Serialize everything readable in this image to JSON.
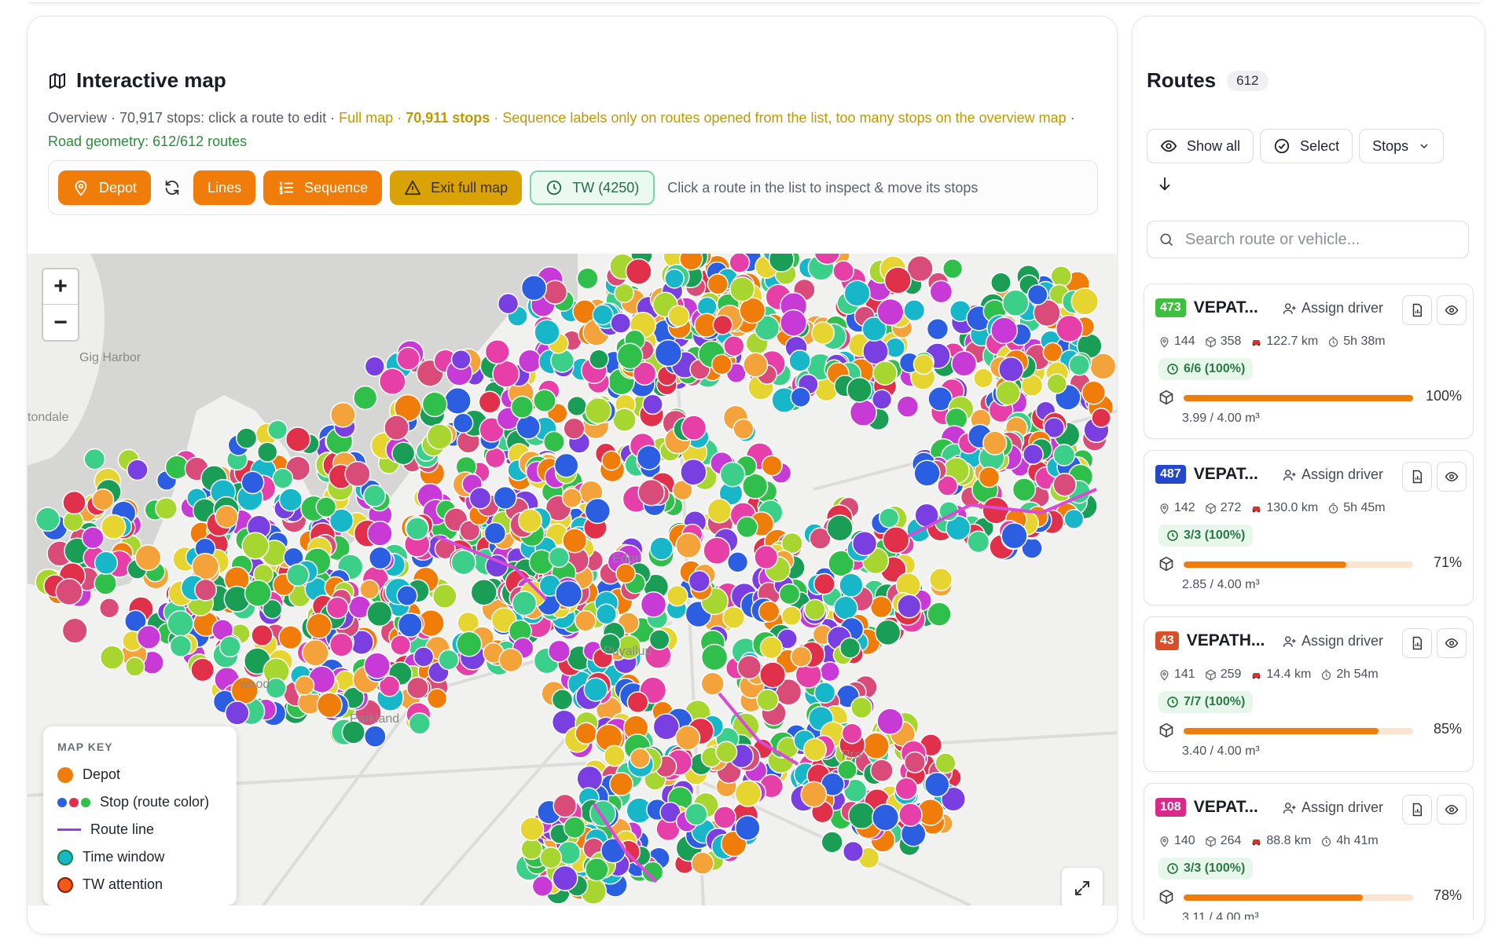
{
  "map": {
    "title": "Interactive map",
    "overview": {
      "part1": "Overview · 70,917 stops: click a route to edit · ",
      "part2": "Full map · ",
      "part3": "70,911 stops",
      "part4": " · Sequence labels only on routes opened from the list, too many stops on the overview map",
      "part5": " · Road geometry: 612/612 routes"
    },
    "toolbar": {
      "depot": "Depot",
      "lines": "Lines",
      "sequence": "Sequence",
      "exit_full_map": "Exit full map",
      "tw": "TW (4250)",
      "hint": "Click a route in the list to inspect & move its stops"
    },
    "places": [
      "Gig Harbor",
      "tondale",
      "Edge",
      "Puyallup",
      "wood",
      "Parkland",
      "Pra"
    ],
    "zoom_in": "+",
    "zoom_out": "−",
    "legend": {
      "title": "MAP KEY",
      "depot": "Depot",
      "stop": "Stop (route color)",
      "route_line": "Route line",
      "time_window": "Time window",
      "tw_attention": "TW attention"
    },
    "colors": {
      "accent": "#f07d0a",
      "warning": "#d9a306",
      "tw_green": "#2a6b46",
      "route_line": "#8e44e0"
    }
  },
  "routes": {
    "title": "Routes",
    "count": "612",
    "show_all": "Show all",
    "select": "Select",
    "stops_dropdown": "Stops",
    "search_placeholder": "Search route or vehicle...",
    "assign_driver": "Assign driver",
    "items": [
      {
        "id": "473",
        "color": "#3fbf3f",
        "name": "VEPAT...",
        "stops": "144",
        "parcels": "358",
        "distance": "122.7 km",
        "duration": "5h 38m",
        "tw": "6/6 (100%)",
        "pct": "100%",
        "fill": 100,
        "volume": "3.99 / 4.00 m³"
      },
      {
        "id": "487",
        "color": "#2547c9",
        "name": "VEPAT...",
        "stops": "142",
        "parcels": "272",
        "distance": "130.0 km",
        "duration": "5h 45m",
        "tw": "3/3 (100%)",
        "pct": "71%",
        "fill": 71,
        "volume": "2.85 / 4.00 m³"
      },
      {
        "id": "43",
        "color": "#d8502a",
        "name": "VEPATH...",
        "stops": "141",
        "parcels": "259",
        "distance": "14.4 km",
        "duration": "2h 54m",
        "tw": "7/7 (100%)",
        "pct": "85%",
        "fill": 85,
        "volume": "3.40 / 4.00 m³"
      },
      {
        "id": "108",
        "color": "#d92a8c",
        "name": "VEPAT...",
        "stops": "140",
        "parcels": "264",
        "distance": "88.8 km",
        "duration": "4h 41m",
        "tw": "3/3 (100%)",
        "pct": "78%",
        "fill": 78,
        "volume": "3.11 / 4.00 m³"
      }
    ]
  }
}
